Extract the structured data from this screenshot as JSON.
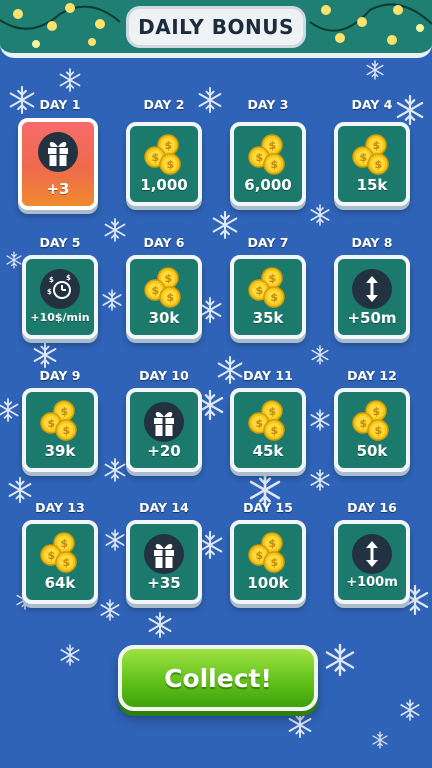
{
  "header": {
    "title": "DAILY BONUS"
  },
  "days": [
    {
      "label": "DAY 1",
      "icon": "gift-icon",
      "amount": "+3",
      "active": true
    },
    {
      "label": "DAY 2",
      "icon": "coins-icon",
      "amount": "1,000",
      "active": false
    },
    {
      "label": "DAY 3",
      "icon": "coins-icon",
      "amount": "6,000",
      "active": false
    },
    {
      "label": "DAY 4",
      "icon": "coins-icon",
      "amount": "15k",
      "active": false
    },
    {
      "label": "DAY 5",
      "icon": "income-clock-icon",
      "amount": "+10$/min",
      "active": false
    },
    {
      "label": "DAY 6",
      "icon": "coins-icon",
      "amount": "30k",
      "active": false
    },
    {
      "label": "DAY 7",
      "icon": "coins-icon",
      "amount": "35k",
      "active": false
    },
    {
      "label": "DAY 8",
      "icon": "height-arrows-icon",
      "amount": "+50m",
      "active": false
    },
    {
      "label": "DAY 9",
      "icon": "coins-icon",
      "amount": "39k",
      "active": false
    },
    {
      "label": "DAY 10",
      "icon": "gift-icon",
      "amount": "+20",
      "active": false
    },
    {
      "label": "DAY 11",
      "icon": "coins-icon",
      "amount": "45k",
      "active": false
    },
    {
      "label": "DAY 12",
      "icon": "coins-icon",
      "amount": "50k",
      "active": false
    },
    {
      "label": "DAY 13",
      "icon": "coins-icon",
      "amount": "64k",
      "active": false
    },
    {
      "label": "DAY 14",
      "icon": "gift-icon",
      "amount": "+35",
      "active": false
    },
    {
      "label": "DAY 15",
      "icon": "coins-icon",
      "amount": "100k",
      "active": false
    },
    {
      "label": "DAY 16",
      "icon": "height-arrows-icon",
      "amount": "+100m",
      "active": false
    }
  ],
  "collect_button": {
    "label": "Collect!"
  },
  "colors": {
    "background": "#2f63b7",
    "card": "#1c7a6c",
    "active_card_top": "#f76b6b",
    "active_card_bottom": "#f08a2e",
    "button_green": "#62c21a",
    "coin_gold": "#f5c518"
  }
}
